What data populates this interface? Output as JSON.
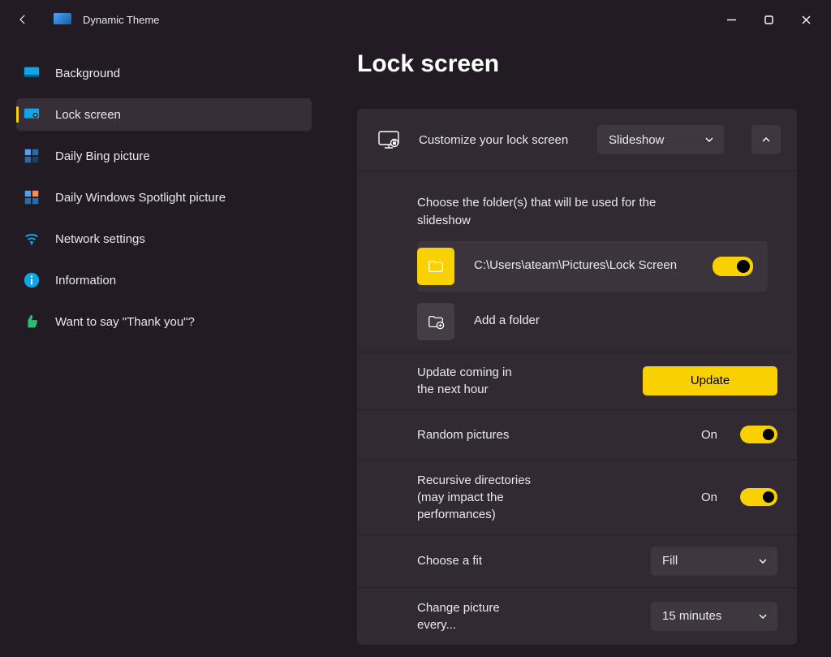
{
  "app": {
    "title": "Dynamic Theme"
  },
  "page": {
    "title": "Lock screen"
  },
  "sidebar": {
    "items": [
      {
        "label": "Background"
      },
      {
        "label": "Lock screen"
      },
      {
        "label": "Daily Bing picture"
      },
      {
        "label": "Daily Windows Spotlight picture"
      },
      {
        "label": "Network settings"
      },
      {
        "label": "Information"
      },
      {
        "label": "Want to say \"Thank you\"?"
      }
    ]
  },
  "main": {
    "customize_label": "Customize your lock screen",
    "mode_selected": "Slideshow",
    "folders_label": "Choose the folder(s) that will be used for the slideshow",
    "folder_path": "C:\\Users\\ateam\\Pictures\\Lock Screen",
    "add_folder_label": "Add a folder",
    "update_status": "Update coming in the next hour",
    "update_button": "Update",
    "random_label": "Random pictures",
    "random_state": "On",
    "recursive_label": "Recursive directories (may impact the performances)",
    "recursive_state": "On",
    "fit_label": "Choose a fit",
    "fit_selected": "Fill",
    "interval_label": "Change picture every...",
    "interval_selected": "15 minutes"
  }
}
